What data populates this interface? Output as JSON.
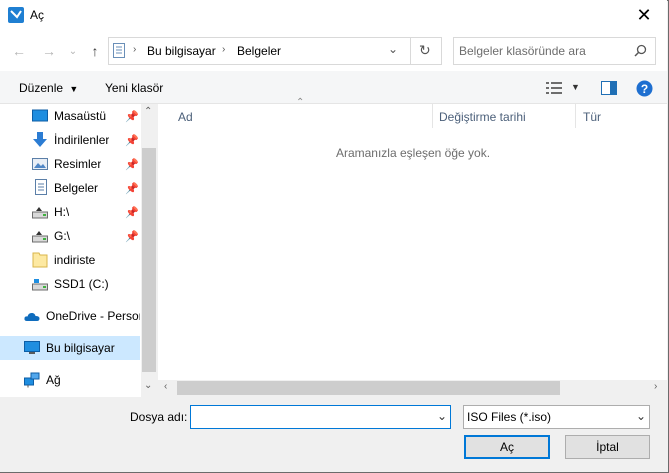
{
  "window": {
    "title": "Aç"
  },
  "address": {
    "root": "Bu bilgisayar",
    "current": "Belgeler"
  },
  "search": {
    "placeholder": "Belgeler klasöründe ara"
  },
  "toolbar": {
    "organize": "Düzenle",
    "new_folder": "Yeni klasör"
  },
  "sidebar": {
    "items": [
      {
        "label": "Masaüstü",
        "icon": "desktop-icon",
        "pinned": true
      },
      {
        "label": "İndirilenler",
        "icon": "download-icon",
        "pinned": true
      },
      {
        "label": "Resimler",
        "icon": "pictures-icon",
        "pinned": true
      },
      {
        "label": "Belgeler",
        "icon": "documents-icon",
        "pinned": true
      },
      {
        "label": "H:\\",
        "icon": "drive-icon",
        "pinned": true
      },
      {
        "label": "G:\\",
        "icon": "drive-icon",
        "pinned": true
      },
      {
        "label": "indiriste",
        "icon": "folder-icon",
        "pinned": false
      },
      {
        "label": "SSD1 (C:)",
        "icon": "ssd-icon",
        "pinned": false
      },
      {
        "label": "OneDrive - Persor",
        "icon": "onedrive-icon",
        "pinned": false
      },
      {
        "label": "Bu bilgisayar",
        "icon": "computer-icon",
        "pinned": false,
        "selected": true
      },
      {
        "label": "Ağ",
        "icon": "network-icon",
        "pinned": false
      }
    ]
  },
  "columns": {
    "name": "Ad",
    "modified": "Değiştirme tarihi",
    "type": "Tür"
  },
  "empty_message": "Aramanızla eşleşen öğe yok.",
  "bottom": {
    "filename_label": "Dosya adı:",
    "filename_value": "",
    "filetype": "ISO Files (*.iso)",
    "open": "Aç",
    "cancel": "İptal"
  },
  "colors": {
    "accent": "#0078d7",
    "selected_bg": "#cce8ff",
    "help": "#1e6fd0"
  }
}
